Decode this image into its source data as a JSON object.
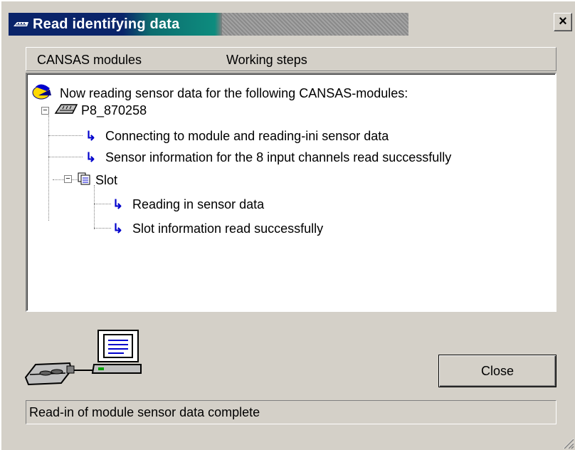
{
  "window": {
    "title": "Read identifying data",
    "close_glyph": "×"
  },
  "columns": {
    "modules": "CANSAS modules",
    "steps": "Working steps"
  },
  "tree": {
    "root": "Now reading sensor data for the following CANSAS-modules:",
    "module": "P8_870258",
    "module_steps": [
      "Connecting to module and reading-ini sensor data",
      "Sensor information for the 8 input channels read successfully"
    ],
    "slot": "Slot",
    "slot_steps": [
      "Reading in sensor data",
      "Slot information read successfully"
    ],
    "collapse_glyph": "−"
  },
  "buttons": {
    "close": "Close"
  },
  "status": {
    "text": "Read-in of module sensor data complete"
  },
  "icons": {
    "title": "device-icon",
    "root": "reading-icon",
    "module": "module-icon",
    "slot": "slot-icon",
    "step": "step-arrow-icon",
    "illustration": "device-computer-icon"
  },
  "colors": {
    "titlebar": "#0a246a",
    "arrow": "#0000cc",
    "face": "#d4d0c8"
  }
}
